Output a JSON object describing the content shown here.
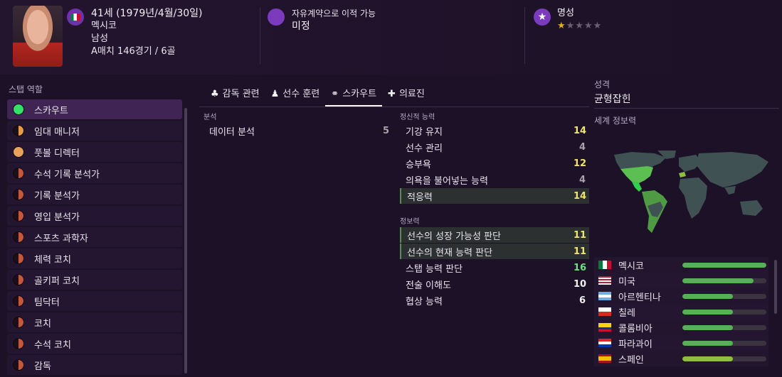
{
  "profile": {
    "age_line": "41세 (1979년/4월/30일)",
    "nationality": "멕시코",
    "gender": "남성",
    "caps": "A매치 146경기 / 6골",
    "contract_label": "자유계약으로 이적 가능",
    "contract_value": "미정",
    "reputation_label": "명성",
    "reputation_stars": 1.5
  },
  "staff": {
    "title": "스탭 역할",
    "roles": [
      {
        "label": "스카우트",
        "selected": true,
        "dot": "#34e06a"
      },
      {
        "label": "임대 매니저",
        "dot": "half-orange"
      },
      {
        "label": "풋볼 디렉터",
        "dot": "#e8a05a"
      },
      {
        "label": "수석 기록 분석가",
        "dot": "half-red"
      },
      {
        "label": "기록 분석가",
        "dot": "half-red"
      },
      {
        "label": "영입 분석가",
        "dot": "half-red"
      },
      {
        "label": "스포츠 과학자",
        "dot": "half-red"
      },
      {
        "label": "체력 코치",
        "dot": "half-red"
      },
      {
        "label": "골키퍼 코치",
        "dot": "half-red"
      },
      {
        "label": "팀닥터",
        "dot": "half-red"
      },
      {
        "label": "코치",
        "dot": "half-red"
      },
      {
        "label": "수석 코치",
        "dot": "half-red"
      },
      {
        "label": "감독",
        "dot": "half-red"
      }
    ]
  },
  "tabs": [
    {
      "label": "감독 관련",
      "icon": "♣"
    },
    {
      "label": "선수 훈련",
      "icon": "♟"
    },
    {
      "label": "스카우트",
      "icon": "⚭",
      "active": true
    },
    {
      "label": "의료진",
      "icon": "✚"
    }
  ],
  "analysis": {
    "title": "분석",
    "rows": [
      {
        "label": "데이터 분석",
        "value": "5"
      }
    ]
  },
  "mental": {
    "title": "정신적 능력",
    "rows": [
      {
        "label": "기강 유지",
        "value": "14",
        "c": "y"
      },
      {
        "label": "선수 관리",
        "value": "4",
        "c": "gr"
      },
      {
        "label": "승부욕",
        "value": "12",
        "c": "y"
      },
      {
        "label": "의욕을 불어넣는 능력",
        "value": "4",
        "c": "gr"
      },
      {
        "label": "적응력",
        "value": "14",
        "c": "y",
        "hl": true
      }
    ]
  },
  "knowledge": {
    "title": "정보력",
    "rows": [
      {
        "label": "선수의 성장 가능성 판단",
        "value": "11",
        "c": "y",
        "hl": true
      },
      {
        "label": "선수의 현재 능력 판단",
        "value": "11",
        "c": "y",
        "hl": true
      },
      {
        "label": "스탭 능력 판단",
        "value": "16",
        "c": "g"
      },
      {
        "label": "전술 이해도",
        "value": "10",
        "c": "w"
      },
      {
        "label": "협상 능력",
        "value": "6",
        "c": "w"
      }
    ]
  },
  "right": {
    "personality_label": "성격",
    "personality_value": "균형잡힌",
    "world_label": "세계 정보력",
    "countries": [
      {
        "label": "멕시코",
        "flag": "mexico-flag",
        "level": 1.0
      },
      {
        "label": "미국",
        "flag": "usa-flag",
        "level": 0.85
      },
      {
        "label": "아르헨티나",
        "flag": "argentina-flag",
        "level": 0.6
      },
      {
        "label": "칠레",
        "flag": "chile-flag",
        "level": 0.6
      },
      {
        "label": "콜롬비아",
        "flag": "colombia-flag",
        "level": 0.6
      },
      {
        "label": "파라과이",
        "flag": "paraguay-flag",
        "level": 0.6
      },
      {
        "label": "스페인",
        "flag": "spain-flag",
        "level": 0.6
      }
    ]
  }
}
